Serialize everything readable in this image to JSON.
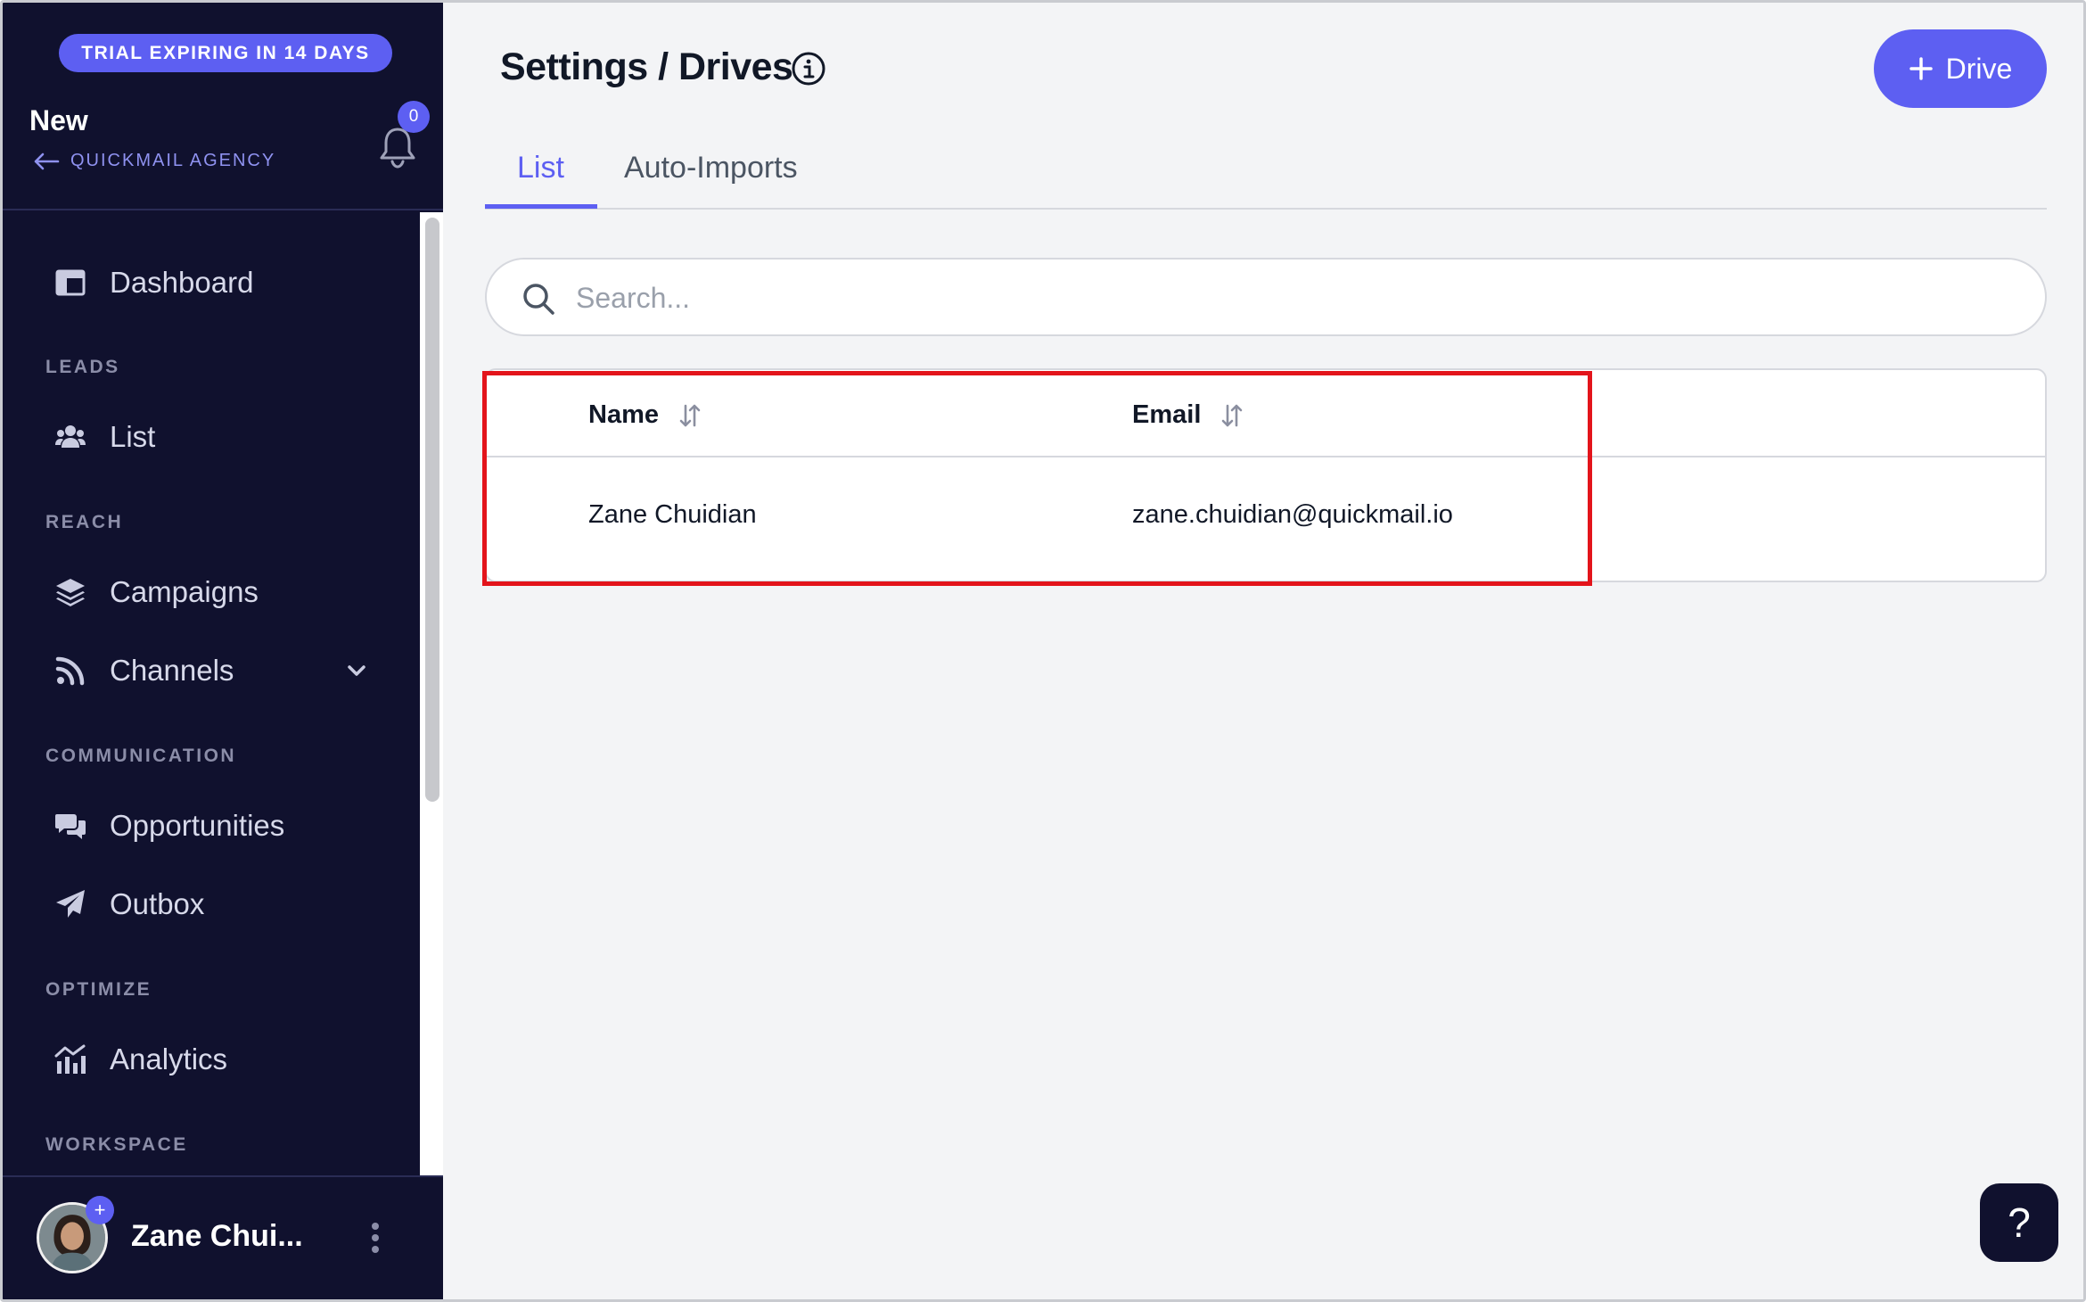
{
  "sidebar": {
    "trial_badge": "TRIAL EXPIRING IN 14 DAYS",
    "workspace_name": "New",
    "agency_link": "QUICKMAIL AGENCY",
    "notification_count": "0",
    "nav": {
      "dashboard": "Dashboard",
      "section_leads": "LEADS",
      "list": "List",
      "section_reach": "REACH",
      "campaigns": "Campaigns",
      "channels": "Channels",
      "section_communication": "COMMUNICATION",
      "opportunities": "Opportunities",
      "outbox": "Outbox",
      "section_optimize": "OPTIMIZE",
      "analytics": "Analytics",
      "section_workspace": "WORKSPACE"
    },
    "user": {
      "name": "Zane Chui...",
      "avatar_plus": "+"
    }
  },
  "header": {
    "title": "Settings / Drives",
    "add_button_label": "Drive"
  },
  "tabs": [
    {
      "label": "List",
      "active": true
    },
    {
      "label": "Auto-Imports",
      "active": false
    }
  ],
  "search": {
    "placeholder": "Search...",
    "value": ""
  },
  "table": {
    "columns": [
      "Name",
      "Email"
    ],
    "rows": [
      {
        "name": "Zane Chuidian",
        "email": "zane.chuidian@quickmail.io"
      }
    ]
  },
  "help_button": "?",
  "colors": {
    "accent": "#5d5ff2",
    "sidebar_bg": "#10112e",
    "highlight": "#e3141b"
  }
}
